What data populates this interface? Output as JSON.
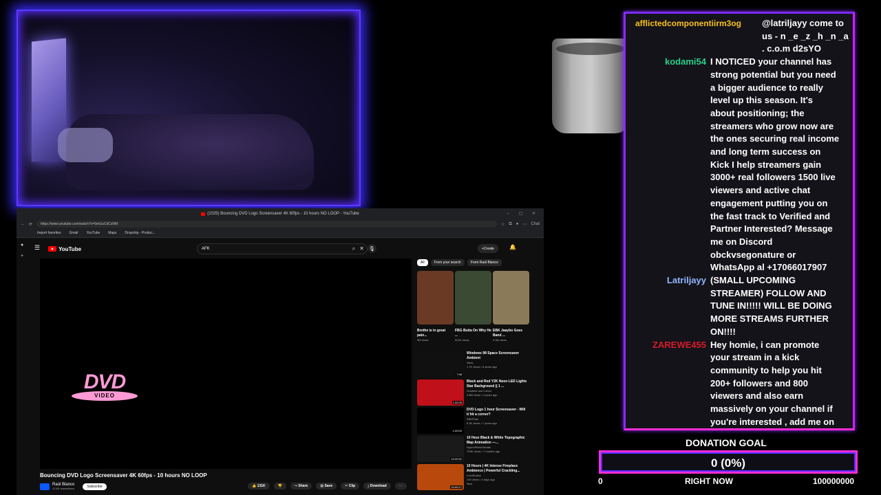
{
  "browser": {
    "window_title": "(1025) Bouncing DVD Logo Screensaver 4K 60fps - 10 hours NO LOOP - YouTube",
    "url": "https://www.youtube.com/watch?v=5mGuCdCsNM",
    "bookmarks": [
      "Import favorites",
      "Gmail",
      "YouTube",
      "Maps",
      "Dropship - Produc..."
    ],
    "profile_label": "Chat"
  },
  "youtube": {
    "logo_text": "YouTube",
    "search_value": "AFK",
    "create_label": "Create",
    "notif_count": "9+",
    "video_title": "Bouncing DVD Logo Screensaver 4K 60fps - 10 hours NO LOOP",
    "channel_name": "Raúl Blanco",
    "channel_subs": "12.6K subscribers",
    "subscribe_label": "Subscribe",
    "likes": "131K",
    "share_label": "Share",
    "save_label": "Save",
    "clip_label": "Clip",
    "download_label": "Download",
    "dvd_text": "DVD",
    "dvd_sub": "VIDEO",
    "chips": [
      "All",
      "From your search",
      "From Raúl Blanco"
    ],
    "shorts": [
      {
        "title": "Brothe is in great pain...",
        "views": "9M views",
        "color": "#6b3a25"
      },
      {
        "title": "FBG Butta On Why He ...",
        "views": "522K views",
        "color": "#3b4a33"
      },
      {
        "title": "EBK Jaaybo Goes Band ...",
        "views": "3.3M views",
        "color": "#8a7a5a"
      }
    ],
    "recommended": [
      {
        "title": "Windows 98 Space Screensaver Ambient",
        "channel": "Noris",
        "meta": "1.7K views • 6 years ago",
        "duration": "7:58",
        "color": "#101010"
      },
      {
        "title": "Black and Red Y2K Neon LED Lights Star Background || 1 ...",
        "channel": "Gradient and Colour",
        "meta": "3.8M views • 3 years ago",
        "duration": "1:00:05",
        "color": "#c0101a"
      },
      {
        "title": "DVD Logo 1 hour Screensaver - Will it hit a corner?",
        "channel": "EBKPoke",
        "meta": "8.3K views • 7 years ago",
        "duration": "1:00:00",
        "color": "#000000"
      },
      {
        "title": "10 Hour Black & White Topographic Map Animation —...",
        "channel": "HypnoRhinoVisuals",
        "meta": "793K views • 7 months ago",
        "duration": "10:20:51",
        "color": "#1a1a1a"
      },
      {
        "title": "10 Hours | 4K Intense Fireplace Ambience | Powerful Crackling...",
        "channel": "LumiSolace",
        "meta": "145 views • 3 days ago",
        "duration": "10:00:17",
        "color": "#b8480c"
      }
    ],
    "new_badge": "New"
  },
  "chat": {
    "messages": [
      {
        "user": "afflictedcomponentiirm3og",
        "color": "#f7c21a",
        "text": "@latriljayy come to us - n _e _z _h _n _a . c.o.m d2sYO"
      },
      {
        "user": "kodami54",
        "color": "#27d08a",
        "text": "I NOTICED your channel has strong potential but you need a bigger audience to really level up this season. It's about positioning; the streamers who grow now are the ones securing real income and long term success on Kick I help streamers gain 3000+ real followers 1500 live viewers and active chat engagement putting you on the fast track to Verified and Partner Interested? Message me on Discord obckvsegonature or WhatsApp al +17066017907"
      },
      {
        "user": "Latriljayy",
        "color": "#8fb8ff",
        "text": "(SMALL UPCOMING STREAMER) FOLLOW AND TUNE IN!!!!! WILL BE DOING MORE STREAMS FURTHER ON!!!!"
      },
      {
        "user": "ZAREWE455",
        "color": "#d81b2a",
        "text": "Hey homie, i can promote your stream in a kick community to help you hit 200+ followers and 800 viewers and also earn massively on your channel if you're interested , add me on discord>>> heritet"
      }
    ]
  },
  "donation": {
    "title": "DONATION GOAL",
    "value": "0 (0%)",
    "progress": 0,
    "min": "0",
    "now_label": "RIGHT NOW",
    "max": "100000000"
  }
}
